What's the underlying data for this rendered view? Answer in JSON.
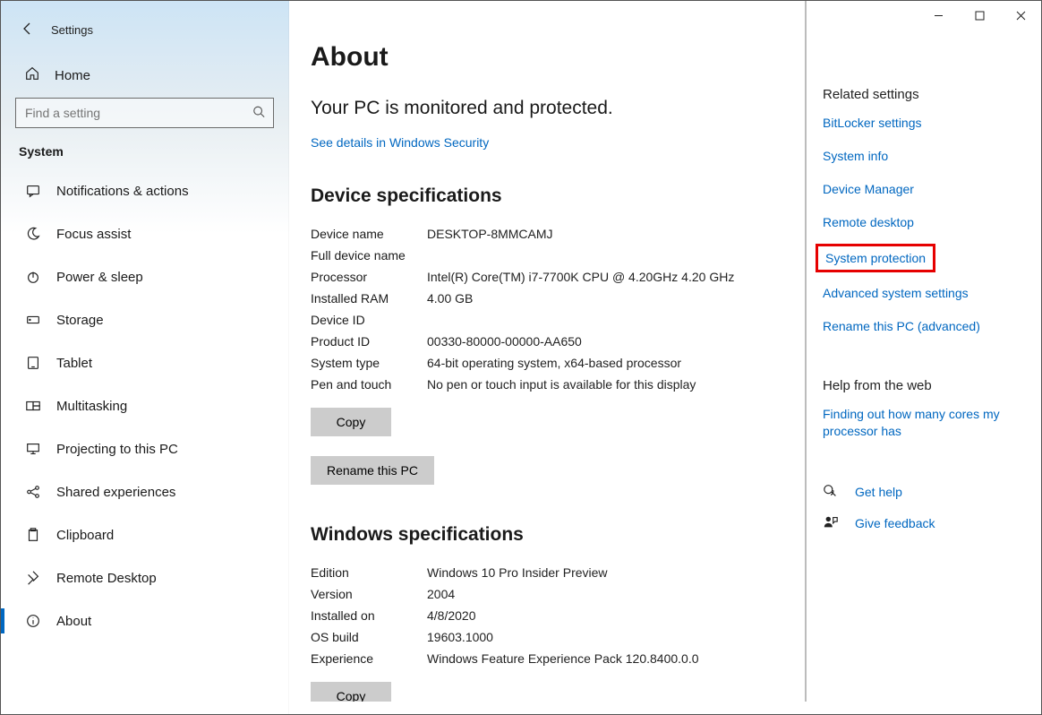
{
  "titlebar": {
    "app_name": "Settings"
  },
  "sidebar": {
    "home_label": "Home",
    "search_placeholder": "Find a setting",
    "category": "System",
    "items": [
      {
        "label": "Notifications & actions"
      },
      {
        "label": "Focus assist"
      },
      {
        "label": "Power & sleep"
      },
      {
        "label": "Storage"
      },
      {
        "label": "Tablet"
      },
      {
        "label": "Multitasking"
      },
      {
        "label": "Projecting to this PC"
      },
      {
        "label": "Shared experiences"
      },
      {
        "label": "Clipboard"
      },
      {
        "label": "Remote Desktop"
      },
      {
        "label": "About"
      }
    ]
  },
  "page": {
    "title": "About",
    "monitored_line": "Your PC is monitored and protected.",
    "security_link": "See details in Windows Security",
    "device_spec_heading": "Device specifications",
    "device_specs": {
      "device_name_k": "Device name",
      "device_name_v": "DESKTOP-8MMCAMJ",
      "full_name_k": "Full device name",
      "full_name_v": "",
      "processor_k": "Processor",
      "processor_v": "Intel(R) Core(TM) i7-7700K CPU @ 4.20GHz   4.20 GHz",
      "ram_k": "Installed RAM",
      "ram_v": "4.00 GB",
      "device_id_k": "Device ID",
      "device_id_v": "",
      "product_id_k": "Product ID",
      "product_id_v": "00330-80000-00000-AA650",
      "system_type_k": "System type",
      "system_type_v": "64-bit operating system, x64-based processor",
      "pen_touch_k": "Pen and touch",
      "pen_touch_v": "No pen or touch input is available for this display"
    },
    "copy_label": "Copy",
    "rename_label": "Rename this PC",
    "win_spec_heading": "Windows specifications",
    "win_specs": {
      "edition_k": "Edition",
      "edition_v": "Windows 10 Pro Insider Preview",
      "version_k": "Version",
      "version_v": "2004",
      "installed_on_k": "Installed on",
      "installed_on_v": "4/8/2020",
      "os_build_k": "OS build",
      "os_build_v": "19603.1000",
      "experience_k": "Experience",
      "experience_v": "Windows Feature Experience Pack 120.8400.0.0"
    },
    "copy_label2": "Copy"
  },
  "related": {
    "heading": "Related settings",
    "links": {
      "bitlocker": "BitLocker settings",
      "system_info": "System info",
      "device_manager": "Device Manager",
      "remote_desktop": "Remote desktop",
      "system_protection": "System protection",
      "advanced": "Advanced system settings",
      "rename_adv": "Rename this PC (advanced)"
    },
    "help_heading": "Help from the web",
    "help_link": "Finding out how many cores my processor has",
    "get_help": "Get help",
    "give_feedback": "Give feedback"
  }
}
